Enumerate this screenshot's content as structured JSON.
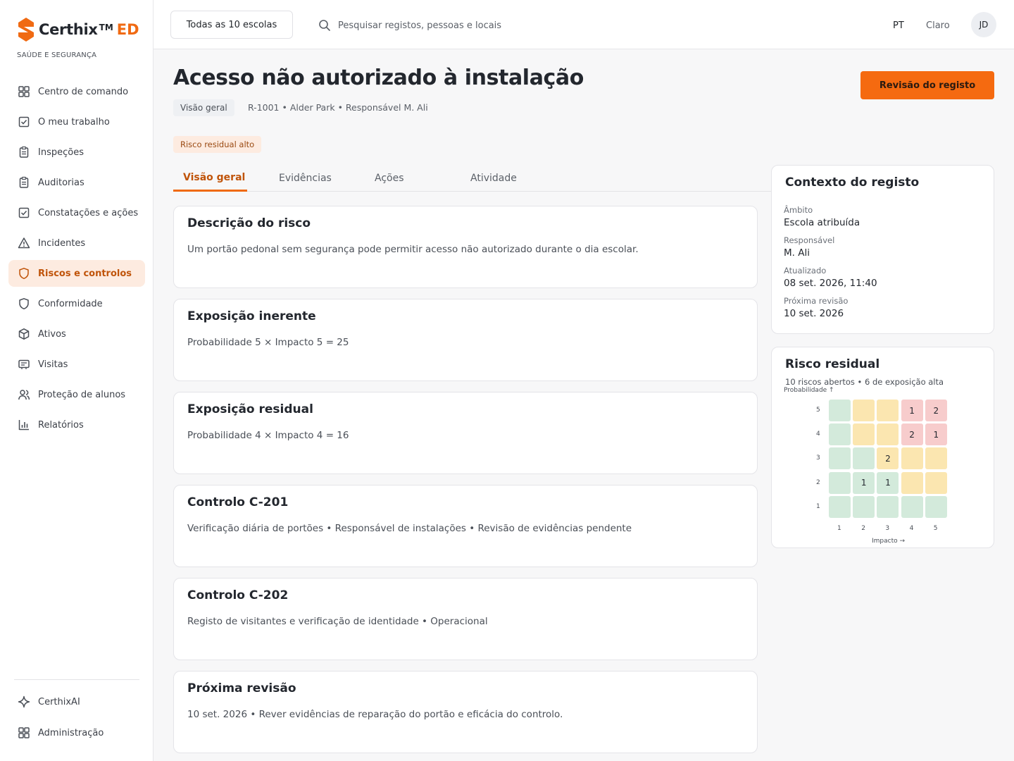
{
  "brand": {
    "name": "Certhix",
    "tm": "TM",
    "suffix": "ED",
    "tagline": "SAÚDE E SEGURANÇA",
    "accent": "#f06a12"
  },
  "sidebar": {
    "items": [
      {
        "label": "Centro de comando",
        "icon": "grid-icon"
      },
      {
        "label": "O meu trabalho",
        "icon": "check-square-icon"
      },
      {
        "label": "Inspeções",
        "icon": "clipboard-icon"
      },
      {
        "label": "Auditorias",
        "icon": "clipboard-icon"
      },
      {
        "label": "Constatações e ações",
        "icon": "check-square-icon"
      },
      {
        "label": "Incidentes",
        "icon": "warning-icon"
      },
      {
        "label": "Riscos e controlos",
        "icon": "shield-icon",
        "active": true
      },
      {
        "label": "Conformidade",
        "icon": "shield-icon"
      },
      {
        "label": "Ativos",
        "icon": "box-icon"
      },
      {
        "label": "Visitas",
        "icon": "id-card-icon"
      },
      {
        "label": "Proteção de alunos",
        "icon": "users-icon"
      },
      {
        "label": "Relatórios",
        "icon": "bar-chart-icon"
      }
    ],
    "bottom": [
      {
        "label": "CerthixAI",
        "icon": "sparkle-icon"
      },
      {
        "label": "Administração",
        "icon": "grid-icon"
      }
    ]
  },
  "topbar": {
    "school_select": "Todas as 10 escolas",
    "search_placeholder": "Pesquisar registos, pessoas e locais",
    "language": "PT",
    "theme": "Claro",
    "avatar": "JD"
  },
  "header": {
    "title": "Acesso não autorizado à instalação",
    "crumb": "Visão geral",
    "meta": "R-1001 • Alder Park • Responsável M. Ali",
    "risk_badge": "Risco residual alto",
    "review_button": "Revisão do registo"
  },
  "tabs": [
    "Visão geral",
    "Evidências",
    "Ações",
    "Atividade"
  ],
  "cards": [
    {
      "title": "Descrição do risco",
      "body": "Um portão pedonal sem segurança pode permitir acesso não autorizado durante o dia escolar."
    },
    {
      "title": "Exposição inerente",
      "body": "Probabilidade 5 × Impacto 5 = 25"
    },
    {
      "title": "Exposição residual",
      "body": "Probabilidade 4 × Impacto 4 = 16"
    },
    {
      "title": "Controlo C-201",
      "body": "Verificação diária de portões • Responsável de instalações • Revisão de evidências pendente"
    },
    {
      "title": "Controlo C-202",
      "body": "Registo de visitantes e verificação de identidade • Operacional"
    },
    {
      "title": "Próxima revisão",
      "body": "10 set. 2026 • Rever evidências de reparação do portão e eficácia do controlo."
    }
  ],
  "context": {
    "title": "Contexto do registo",
    "fields": [
      {
        "label": "Âmbito",
        "value": "Escola atribuída"
      },
      {
        "label": "Responsável",
        "value": "M. Ali"
      },
      {
        "label": "Atualizado",
        "value": "08 set. 2026, 11:40"
      },
      {
        "label": "Próxima revisão",
        "value": "10 set. 2026"
      }
    ]
  },
  "residual": {
    "title": "Risco residual",
    "subtitle": "10 riscos abertos • 6 de exposição alta",
    "y_axis_label": "Probabilidade ↑",
    "x_axis_label": "Impacto →",
    "x_ticks": [
      "1",
      "2",
      "3",
      "4",
      "5"
    ],
    "y_ticks": [
      "5",
      "4",
      "3",
      "2",
      "1"
    ],
    "colors": {
      "low": "#d3eadb",
      "medium": "#fbe6b0",
      "high": "#f7cccc"
    },
    "matrix": [
      [
        {
          "level": "low",
          "count": ""
        },
        {
          "level": "medium",
          "count": ""
        },
        {
          "level": "medium",
          "count": ""
        },
        {
          "level": "high",
          "count": "1"
        },
        {
          "level": "high",
          "count": "2"
        }
      ],
      [
        {
          "level": "low",
          "count": ""
        },
        {
          "level": "medium",
          "count": ""
        },
        {
          "level": "medium",
          "count": ""
        },
        {
          "level": "high",
          "count": "2"
        },
        {
          "level": "high",
          "count": "1"
        }
      ],
      [
        {
          "level": "low",
          "count": ""
        },
        {
          "level": "low",
          "count": ""
        },
        {
          "level": "medium",
          "count": "2"
        },
        {
          "level": "medium",
          "count": ""
        },
        {
          "level": "medium",
          "count": ""
        }
      ],
      [
        {
          "level": "low",
          "count": ""
        },
        {
          "level": "low",
          "count": "1"
        },
        {
          "level": "low",
          "count": "1"
        },
        {
          "level": "medium",
          "count": ""
        },
        {
          "level": "medium",
          "count": ""
        }
      ],
      [
        {
          "level": "low",
          "count": ""
        },
        {
          "level": "low",
          "count": ""
        },
        {
          "level": "low",
          "count": ""
        },
        {
          "level": "low",
          "count": ""
        },
        {
          "level": "low",
          "count": ""
        }
      ]
    ]
  }
}
